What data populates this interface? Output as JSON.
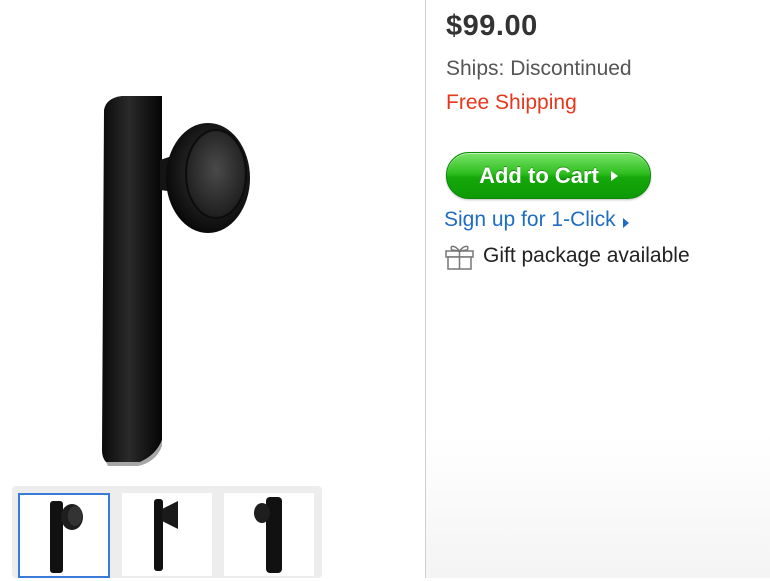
{
  "product": {
    "price": "$99.00",
    "ships": "Ships: Discontinued",
    "free_shipping": "Free Shipping",
    "add_to_cart": "Add to Cart",
    "one_click": "Sign up for 1-Click",
    "gift": "Gift package available"
  },
  "thumbnails": [
    {
      "name": "front-view",
      "selected": true
    },
    {
      "name": "side-view",
      "selected": false
    },
    {
      "name": "back-view",
      "selected": false
    }
  ],
  "colors": {
    "price": "#333333",
    "free_shipping": "#e8361c",
    "cart_button": "#14a80a",
    "link": "#1f6dc2",
    "thumb_selected_border": "#3b7bd8"
  }
}
